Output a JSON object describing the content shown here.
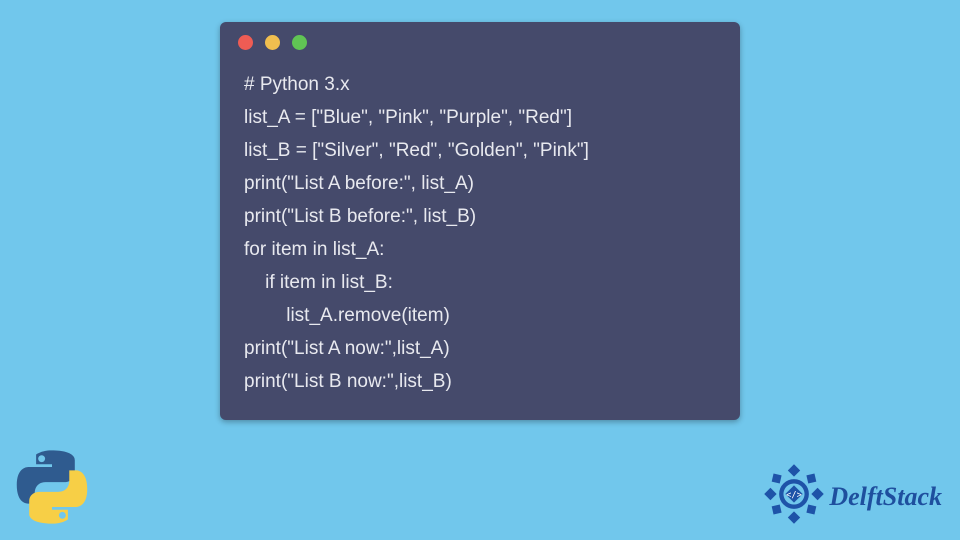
{
  "code": {
    "lines": [
      "# Python 3.x",
      "list_A = [\"Blue\", \"Pink\", \"Purple\", \"Red\"]",
      "list_B = [\"Silver\", \"Red\", \"Golden\", \"Pink\"]",
      "print(\"List A before:\", list_A)",
      "print(\"List B before:\", list_B)",
      "for item in list_A:",
      "    if item in list_B:",
      "        list_A.remove(item)",
      "print(\"List A now:\",list_A)",
      "print(\"List B now:\",list_B)"
    ]
  },
  "brand": {
    "name": "DelftStack"
  },
  "window": {
    "dots": [
      "red",
      "yellow",
      "green"
    ]
  }
}
